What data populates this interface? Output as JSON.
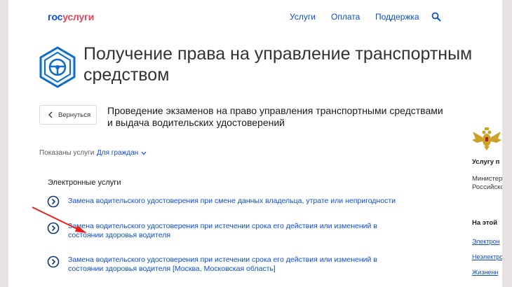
{
  "header": {
    "logo_part1": "гос",
    "logo_part2": "услуги",
    "nav": [
      "Услуги",
      "Оплата",
      "Поддержка"
    ]
  },
  "page_title": "Получение права на управление транспортным средством",
  "back_button_label": "Вернуться",
  "subtitle": "Проведение экзаменов на право управления транспортными средствами и выдача водительских удостоверений",
  "filter": {
    "label": "Показаны услуги",
    "value": "Для граждан"
  },
  "section_title": "Электронные услуги",
  "services": [
    "Замена водительского удостоверения при смене данных владельца, утрате или непригодности",
    "Замена водительского удостоверения при истечении срока его действия или изменений в состоянии здоровья водителя",
    "Замена водительского удостоверения при истечении срока его действия или изменений в состоянии здоровья водителя [Москва, Московская область]"
  ],
  "right_panel": {
    "provider_heading": "Услугу п",
    "provider_line1": "Министер",
    "provider_line2": "Российско",
    "section_heading": "На этой",
    "links": [
      "Электрон",
      "Неэлектро",
      "Жизненн"
    ]
  },
  "colors": {
    "link_blue": "#0d4cd3",
    "logo_red": "#ee3f58",
    "annotation_red": "#e8221b"
  },
  "icons": {
    "search": "search-icon",
    "emblem": "steering-wheel-icon",
    "back": "chevron-left-icon",
    "dropdown": "chevron-down-icon",
    "service": "circle-chevron-right-icon",
    "eagle": "eagle-emblem-icon",
    "annotation": "red-arrow-icon"
  }
}
